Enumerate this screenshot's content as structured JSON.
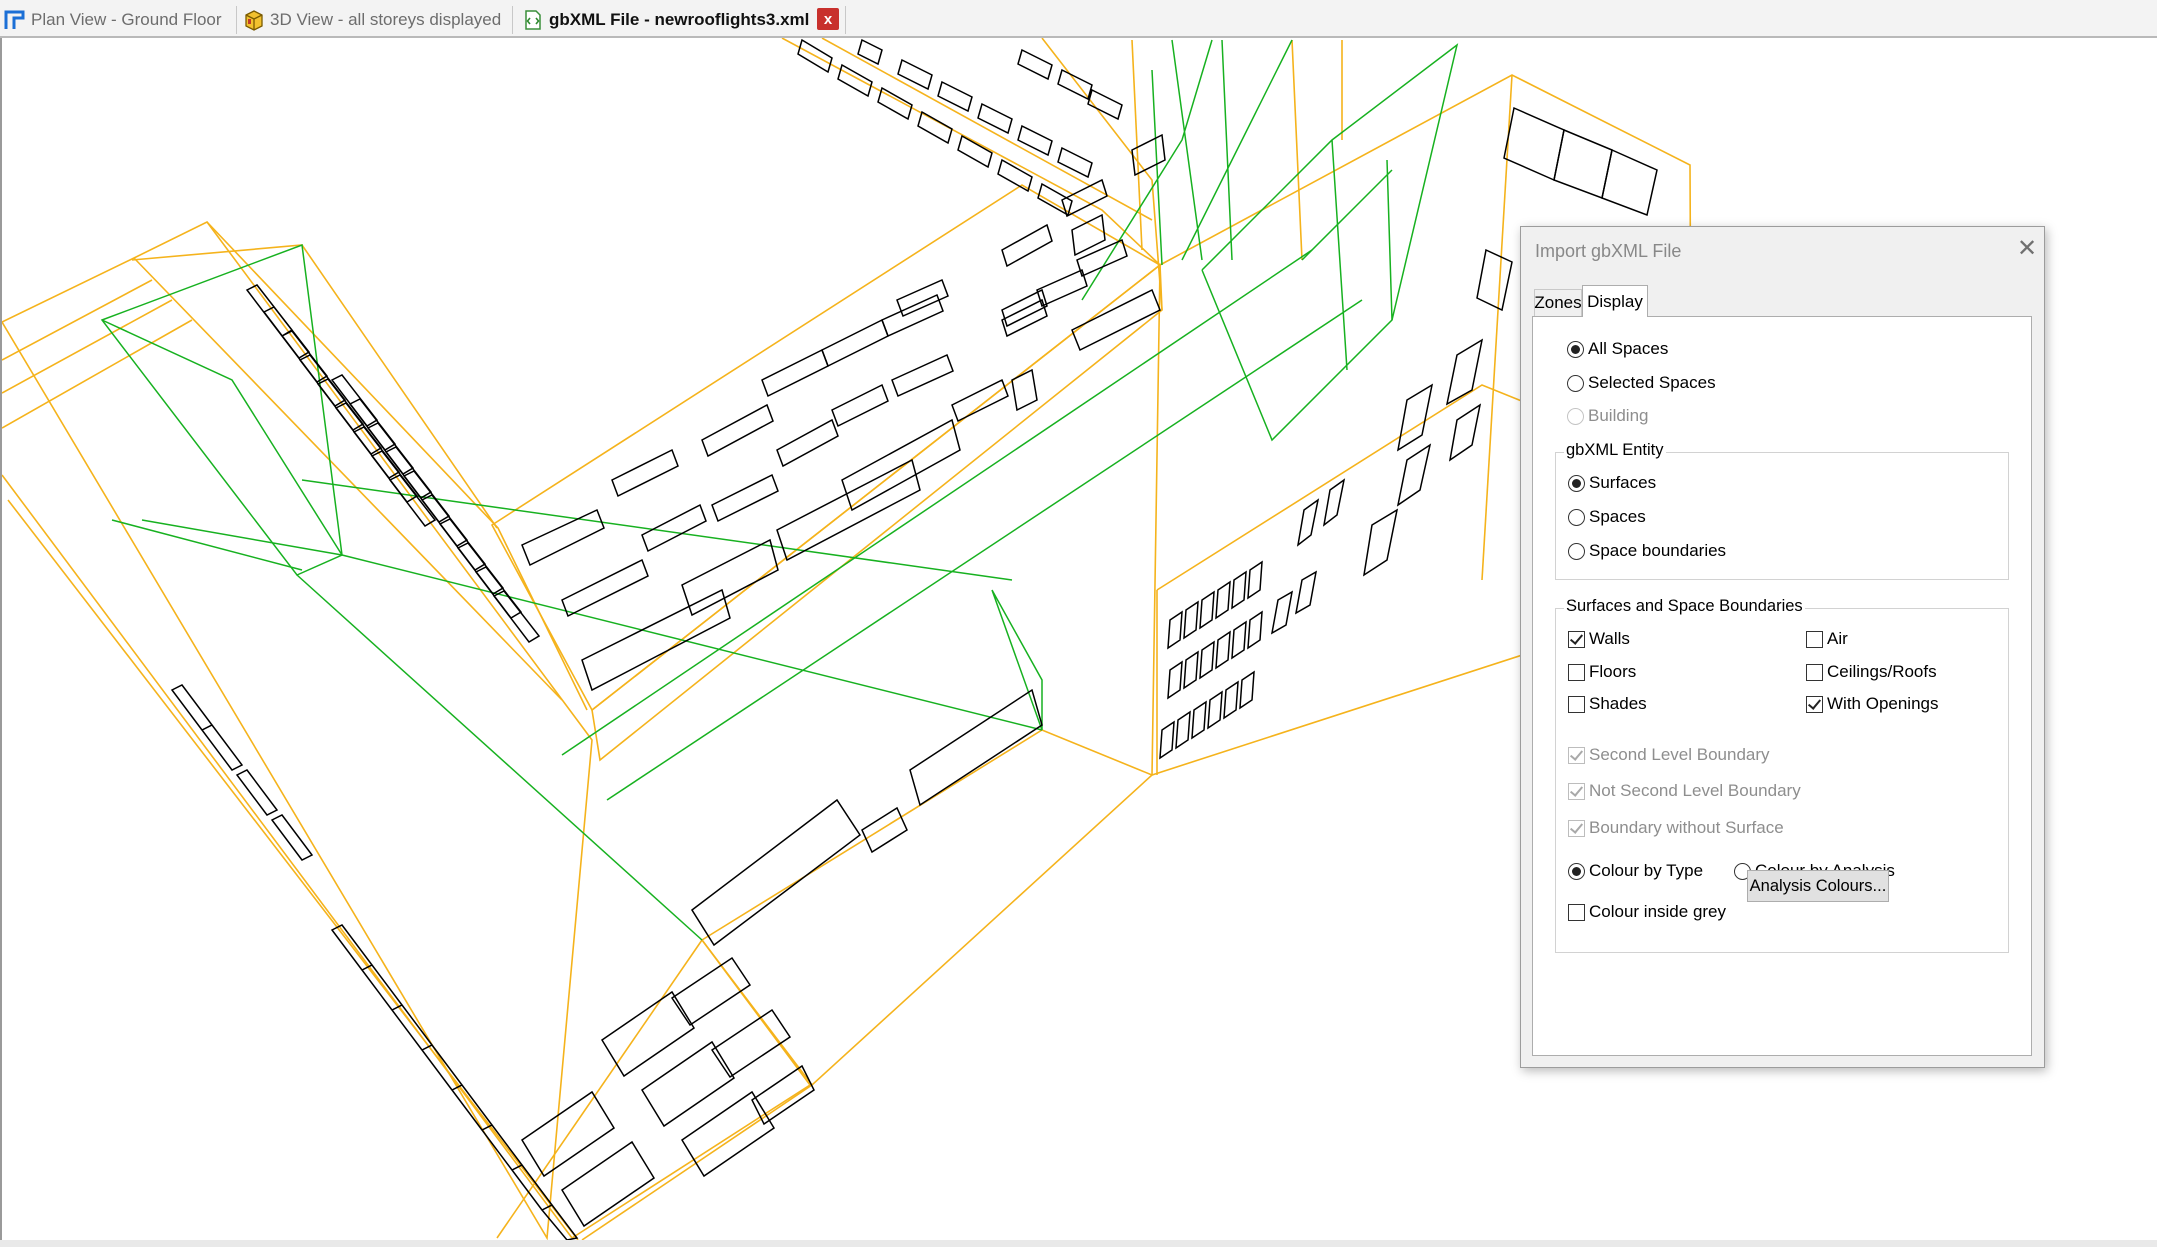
{
  "tabs": [
    {
      "label": "Plan View - Ground Floor",
      "icon": "plan-view-icon",
      "active": false
    },
    {
      "label": "3D View - all storeys displayed",
      "icon": "3d-view-icon",
      "active": false
    },
    {
      "label": "gbXML File - newrooflights3.xml",
      "icon": "xml-file-icon",
      "active": true
    }
  ],
  "tab_close_glyph": "x",
  "colors": {
    "building_outline": "#f5b31c",
    "space_outline": "#17b120",
    "openings": "#000000",
    "close_button": "#c8302c"
  },
  "dialog": {
    "title": "Import gbXML File",
    "close_glyph": "✕",
    "tabs": [
      "Zones",
      "Display"
    ],
    "active_tab": "Display",
    "show": {
      "options": [
        {
          "label": "All Spaces",
          "checked": true,
          "enabled": true
        },
        {
          "label": "Selected Spaces",
          "checked": false,
          "enabled": true
        },
        {
          "label": "Building",
          "checked": false,
          "enabled": false
        }
      ]
    },
    "entity": {
      "title": "gbXML Entity",
      "options": [
        {
          "label": "Surfaces",
          "checked": true
        },
        {
          "label": "Spaces",
          "checked": false
        },
        {
          "label": "Space boundaries",
          "checked": false
        }
      ]
    },
    "surfaces": {
      "title": "Surfaces and Space Boundaries",
      "types": [
        {
          "label": "Walls",
          "checked": true
        },
        {
          "label": "Air",
          "checked": false
        },
        {
          "label": "Floors",
          "checked": false
        },
        {
          "label": "Ceilings/Roofs",
          "checked": false
        },
        {
          "label": "Shades",
          "checked": false
        },
        {
          "label": "With Openings",
          "checked": true
        }
      ],
      "boundaries": [
        {
          "label": "Second Level Boundary",
          "checked": true,
          "enabled": false
        },
        {
          "label": "Not Second Level Boundary",
          "checked": true,
          "enabled": false
        },
        {
          "label": "Boundary without Surface",
          "checked": true,
          "enabled": false
        }
      ],
      "colour_by_type": {
        "label": "Colour by Type",
        "checked": true
      },
      "colour_by_analysis": {
        "label": "Colour by Analysis",
        "checked": false
      },
      "colour_inside_grey": {
        "label": "Colour inside grey",
        "checked": false
      },
      "analysis_button": "Analysis Colours..."
    }
  }
}
